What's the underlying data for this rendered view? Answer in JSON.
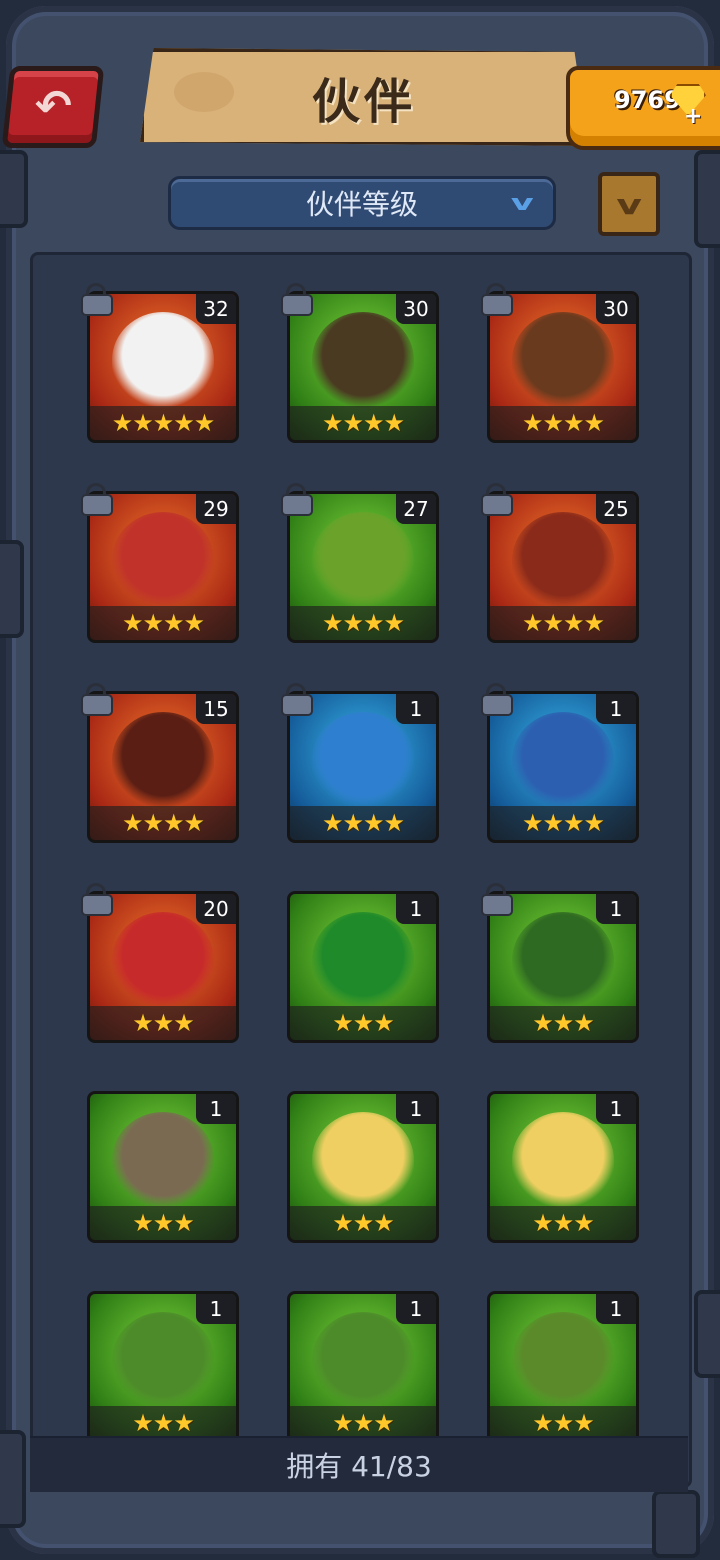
{
  "header": {
    "title": "伙伴",
    "gems": "9769",
    "gem_plus": "+"
  },
  "filter": {
    "label": "伙伴等级"
  },
  "footer": {
    "owned": "拥有 41/83"
  },
  "colors": {
    "orange_card": "#c84a1a",
    "green_card": "#4ea82a",
    "blue_card": "#2185c8",
    "star": "#ffc72a"
  },
  "companions": [
    {
      "level": "32",
      "stars": "★★★★★",
      "bg": "orange",
      "locked": true,
      "portrait": "panda"
    },
    {
      "level": "30",
      "stars": "★★★★",
      "bg": "green",
      "locked": true,
      "portrait": "dark-haired-woman"
    },
    {
      "level": "30",
      "stars": "★★★★",
      "bg": "orange",
      "locked": true,
      "portrait": "long-haired-man"
    },
    {
      "level": "29",
      "stars": "★★★★",
      "bg": "orange",
      "locked": true,
      "portrait": "red-hat-goblin"
    },
    {
      "level": "27",
      "stars": "★★★★",
      "bg": "green",
      "locked": true,
      "portrait": "green-haired-woman"
    },
    {
      "level": "25",
      "stars": "★★★★",
      "bg": "orange",
      "locked": true,
      "portrait": "red-bearded-warrior"
    },
    {
      "level": "15",
      "stars": "★★★★",
      "bg": "orange",
      "locked": true,
      "portrait": "afro-woman"
    },
    {
      "level": "1",
      "stars": "★★★★",
      "bg": "blue",
      "locked": true,
      "portrait": "blue-haired-troll"
    },
    {
      "level": "1",
      "stars": "★★★★",
      "bg": "blue",
      "locked": true,
      "portrait": "blue-hat-goblin"
    },
    {
      "level": "20",
      "stars": "★★★",
      "bg": "orange",
      "locked": true,
      "portrait": "red-dinosaur"
    },
    {
      "level": "1",
      "stars": "★★★",
      "bg": "green",
      "locked": false,
      "portrait": "green-crocodile"
    },
    {
      "level": "1",
      "stars": "★★★",
      "bg": "green",
      "locked": true,
      "portrait": "green-bearded-man"
    },
    {
      "level": "1",
      "stars": "★★★",
      "bg": "green",
      "locked": false,
      "portrait": "ogre"
    },
    {
      "level": "1",
      "stars": "★★★",
      "bg": "green",
      "locked": false,
      "portrait": "blonde-woman"
    },
    {
      "level": "1",
      "stars": "★★★",
      "bg": "green",
      "locked": false,
      "portrait": "blonde-woman"
    },
    {
      "level": "1",
      "stars": "★★★",
      "bg": "green",
      "locked": false,
      "portrait": "boar-orc"
    },
    {
      "level": "1",
      "stars": "★★★",
      "bg": "green",
      "locked": false,
      "portrait": "boar-orc"
    },
    {
      "level": "1",
      "stars": "★★★",
      "bg": "green",
      "locked": false,
      "portrait": "elf-woman"
    }
  ]
}
